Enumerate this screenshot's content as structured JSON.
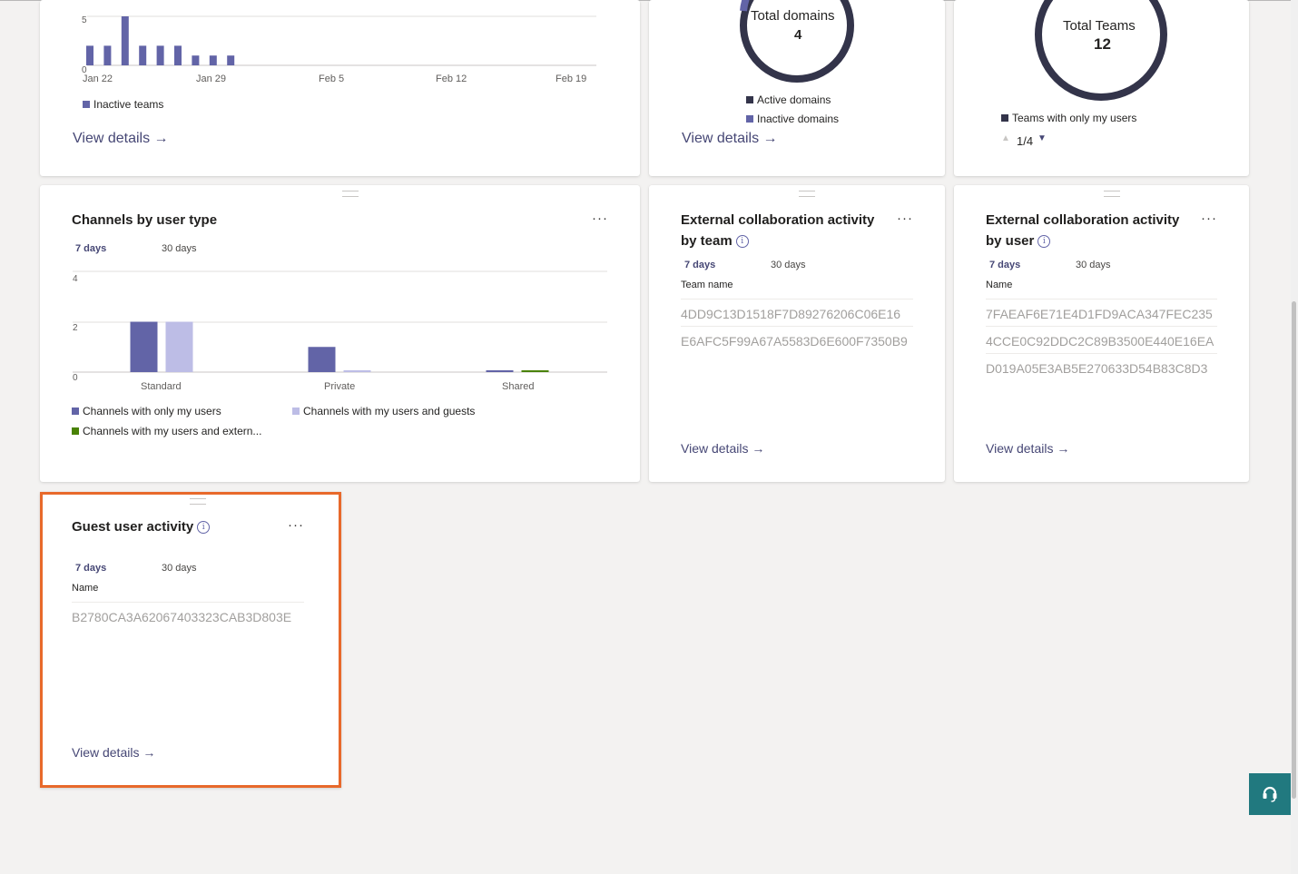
{
  "inactive_teams_card": {
    "y_ticks": [
      "5",
      "0"
    ],
    "x_labels": [
      "Jan 22",
      "Jan 29",
      "Feb 5",
      "Feb 12",
      "Feb 19"
    ],
    "legend": "Inactive teams",
    "view_details": "View details →",
    "chart_data": {
      "type": "bar",
      "values": [
        2,
        2,
        5,
        2,
        2,
        2,
        1,
        1,
        1
      ],
      "ylim": [
        0,
        5
      ],
      "series_color": "#6264a7"
    }
  },
  "domains_card": {
    "label": "Total domains",
    "value": "4",
    "legend": [
      "Active domains",
      "Inactive domains"
    ],
    "view_details": "View details →"
  },
  "teams_card": {
    "label": "Total Teams",
    "value": "12",
    "legend": "Teams with only my users",
    "pager": "1/4",
    "pager_up": "▲",
    "pager_down": "▼"
  },
  "channels_card": {
    "title": "Channels by user type",
    "more": "···",
    "tabs": [
      "7 days",
      "30 days"
    ],
    "y_ticks": [
      "4",
      "2",
      "0"
    ],
    "categories": [
      "Standard",
      "Private",
      "Shared"
    ],
    "legend": [
      "Channels with only my users",
      "Channels with my users and guests",
      "Channels with my users and extern..."
    ],
    "chart_data": {
      "type": "bar",
      "categories": [
        "Standard",
        "Private",
        "Shared"
      ],
      "series": [
        {
          "name": "Channels with only my users",
          "values": [
            2,
            1,
            0
          ],
          "color": "#6264a7"
        },
        {
          "name": "Channels with my users and guests",
          "values": [
            2,
            0,
            0
          ],
          "color": "#bdbde6"
        },
        {
          "name": "Channels with my users and extern...",
          "values": [
            0,
            0,
            0
          ],
          "color": "#498205"
        }
      ],
      "ylim": [
        0,
        4
      ]
    }
  },
  "ext_team_card": {
    "title_line1": "External collaboration activity",
    "title_line2": "by team",
    "info": "i",
    "more": "···",
    "tabs": [
      "7 days",
      "30 days"
    ],
    "column": "Team name",
    "rows": [
      "4DD9C13D1518F7D89276206C06E16",
      "E6AFC5F99A67A5583D6E600F7350B9"
    ],
    "view_details": "View details",
    "arrow": "→"
  },
  "ext_user_card": {
    "title_line1": "External collaboration activity",
    "title_line2": "by user",
    "info": "i",
    "more": "···",
    "tabs": [
      "7 days",
      "30 days"
    ],
    "column": "Name",
    "rows": [
      "7FAEAF6E71E4D1FD9ACA347FEC235",
      "4CCE0C92DDC2C89B3500E440E16EA",
      "D019A05E3AB5E270633D54B83C8D3"
    ],
    "view_details": "View details",
    "arrow": "→"
  },
  "guest_card": {
    "title": "Guest user activity",
    "info": "i",
    "more": "···",
    "tabs": [
      "7 days",
      "30 days"
    ],
    "column": "Name",
    "rows": [
      "B2780CA3A62067403323CAB3D803E"
    ],
    "view_details": "View details",
    "arrow": "→"
  },
  "colors": {
    "accent": "#6264a7",
    "dark_ring": "#33344a",
    "light_purple": "#bdbde6",
    "green": "#498205",
    "highlight": "#e8692b",
    "help": "#21797f"
  }
}
